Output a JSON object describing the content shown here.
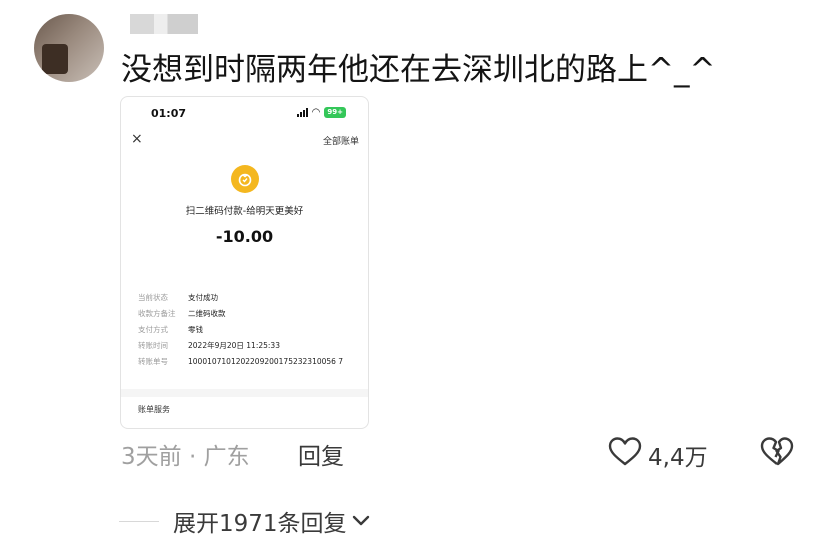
{
  "comment": {
    "text": "没想到时隔两年他还在去深圳北的路上^_^",
    "time_location": "3天前 · 广东",
    "reply_label": "回复",
    "like_count": "4,4万"
  },
  "screenshot": {
    "status_time": "01:07",
    "battery": "99+",
    "close_icon": "×",
    "all_bills": "全部账单",
    "pay_title": "扫二维码付款-给明天更美好",
    "amount": "-10.00",
    "details": [
      {
        "key": "当前状态",
        "value": "支付成功"
      },
      {
        "key": "收款方备注",
        "value": "二维码收款"
      },
      {
        "key": "支付方式",
        "value": "零钱"
      },
      {
        "key": "转账时间",
        "value": "2022年9月20日 11:25:33"
      },
      {
        "key": "转账单号",
        "value": "1000107101202209200175232310056 7"
      }
    ],
    "service": "账单服务"
  },
  "replies": {
    "expand_label": "展开1971条回复"
  },
  "colors": {
    "pay_icon": "#f4b71f",
    "battery": "#34c759",
    "muted_text": "#a0a0a0"
  }
}
